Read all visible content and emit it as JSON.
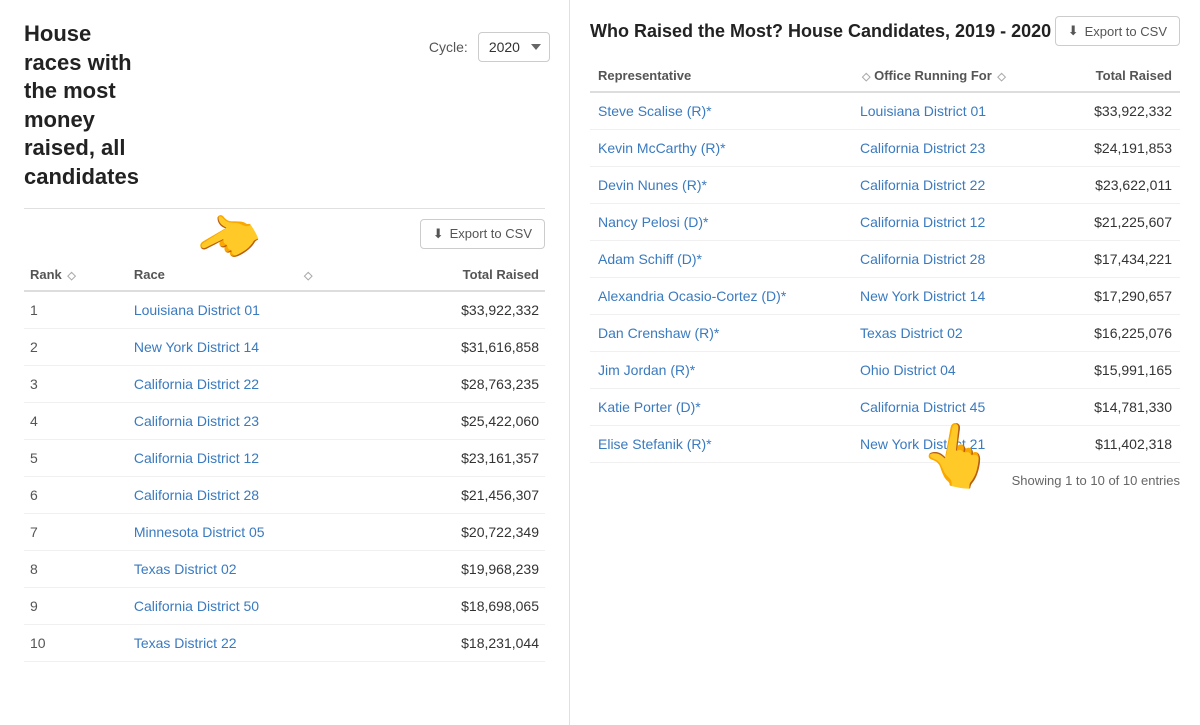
{
  "left": {
    "title": "House races with the most money raised, all candidates",
    "cycle_label": "Cycle:",
    "cycle_value": "2020",
    "export_label": "Export to CSV",
    "table": {
      "columns": [
        "Rank",
        "Race",
        "",
        "Total Raised"
      ],
      "rows": [
        {
          "rank": "1",
          "race": "Louisiana District 01",
          "total": "$33,922,332"
        },
        {
          "rank": "2",
          "race": "New York District 14",
          "total": "$31,616,858"
        },
        {
          "rank": "3",
          "race": "California District 22",
          "total": "$28,763,235"
        },
        {
          "rank": "4",
          "race": "California District 23",
          "total": "$25,422,060"
        },
        {
          "rank": "5",
          "race": "California District 12",
          "total": "$23,161,357"
        },
        {
          "rank": "6",
          "race": "California District 28",
          "total": "$21,456,307"
        },
        {
          "rank": "7",
          "race": "Minnesota District 05",
          "total": "$20,722,349"
        },
        {
          "rank": "8",
          "race": "Texas District 02",
          "total": "$19,968,239"
        },
        {
          "rank": "9",
          "race": "California District 50",
          "total": "$18,698,065"
        },
        {
          "rank": "10",
          "race": "Texas District 22",
          "total": "$18,231,044"
        }
      ]
    }
  },
  "right": {
    "title": "Who Raised the Most? House Candidates, 2019 - 2020",
    "export_label": "Export to CSV",
    "table": {
      "col_representative": "Representative",
      "col_office": "Office Running For",
      "col_total": "Total Raised",
      "rows": [
        {
          "name": "Steve Scalise (R)*",
          "office": "Louisiana District 01",
          "total": "$33,922,332"
        },
        {
          "name": "Kevin McCarthy (R)*",
          "office": "California District 23",
          "total": "$24,191,853"
        },
        {
          "name": "Devin Nunes (R)*",
          "office": "California District 22",
          "total": "$23,622,011"
        },
        {
          "name": "Nancy Pelosi (D)*",
          "office": "California District 12",
          "total": "$21,225,607"
        },
        {
          "name": "Adam Schiff (D)*",
          "office": "California District 28",
          "total": "$17,434,221"
        },
        {
          "name": "Alexandria Ocasio-Cortez (D)*",
          "office": "New York District 14",
          "total": "$17,290,657"
        },
        {
          "name": "Dan Crenshaw (R)*",
          "office": "Texas District 02",
          "total": "$16,225,076"
        },
        {
          "name": "Jim Jordan (R)*",
          "office": "Ohio District 04",
          "total": "$15,991,165"
        },
        {
          "name": "Katie Porter (D)*",
          "office": "California District 45",
          "total": "$14,781,330"
        },
        {
          "name": "Elise Stefanik (R)*",
          "office": "New York District 21",
          "total": "$11,402,318"
        }
      ]
    },
    "showing_text": "Showing 1 to 10 of 10 entries"
  }
}
